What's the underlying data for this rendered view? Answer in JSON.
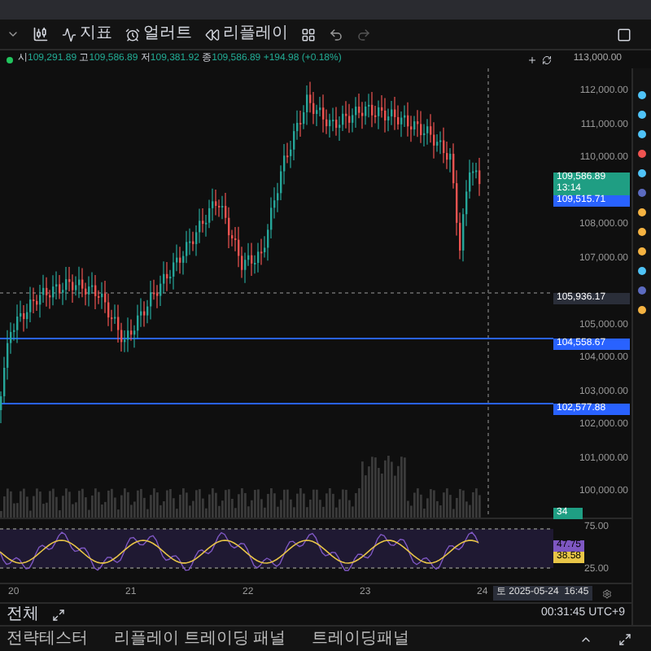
{
  "toolbar": {
    "items": [
      {
        "kind": "text",
        "label": "지표"
      },
      {
        "kind": "text",
        "label": "얼러트"
      },
      {
        "kind": "text",
        "label": "리플레이"
      }
    ]
  },
  "ohlc": {
    "open_label": "시",
    "open": "109,291.89",
    "high_label": "고",
    "high": "109,586.89",
    "low_label": "저",
    "low": "109,381.92",
    "close_label": "종",
    "close": "109,586.89",
    "change": "+194.98 (+0.18%)",
    "top_tick": "113,000.00"
  },
  "price_axis": {
    "ticks": [
      "112,000.00",
      "111,000.00",
      "110,000.00",
      "108,000.00",
      "107,000.00",
      "105,000.00",
      "104,000.00",
      "103,000.00",
      "102,000.00",
      "101,000.00",
      "100,000.00"
    ],
    "badges": [
      {
        "kind": "last",
        "text": "109,586.89",
        "sub": "13:14",
        "color": "#1f9e83"
      },
      {
        "kind": "plain",
        "text": "109,515.71",
        "color": "#2962ff"
      },
      {
        "kind": "crosshair",
        "text": "105,936.17",
        "color": "#2a2e39"
      },
      {
        "kind": "line",
        "text": "104,558.67",
        "color": "#2962ff"
      },
      {
        "kind": "line",
        "text": "102,577.88",
        "color": "#2962ff"
      },
      {
        "kind": "plain",
        "text": "34",
        "color": "#1f9e83"
      }
    ]
  },
  "rsi_axis": {
    "ticks": [
      "75.00",
      "25.00"
    ],
    "badges": [
      {
        "text": "47.75",
        "color": "#7e57c2"
      },
      {
        "text": "38.58",
        "color": "#e8c547"
      }
    ]
  },
  "time_axis": {
    "labels": [
      "20",
      "21",
      "22",
      "23",
      "24"
    ],
    "crosshair": "토 2025-05-24  16:45"
  },
  "footer": {
    "range": "전체",
    "clock": "00:31:45 UTC+9"
  },
  "bottom_tabs": [
    {
      "label": "전략테스터",
      "selected": false
    },
    {
      "label": "리플레이 트레이딩 패널",
      "selected": false
    },
    {
      "label": "트레이딩패널",
      "selected": false
    }
  ]
}
